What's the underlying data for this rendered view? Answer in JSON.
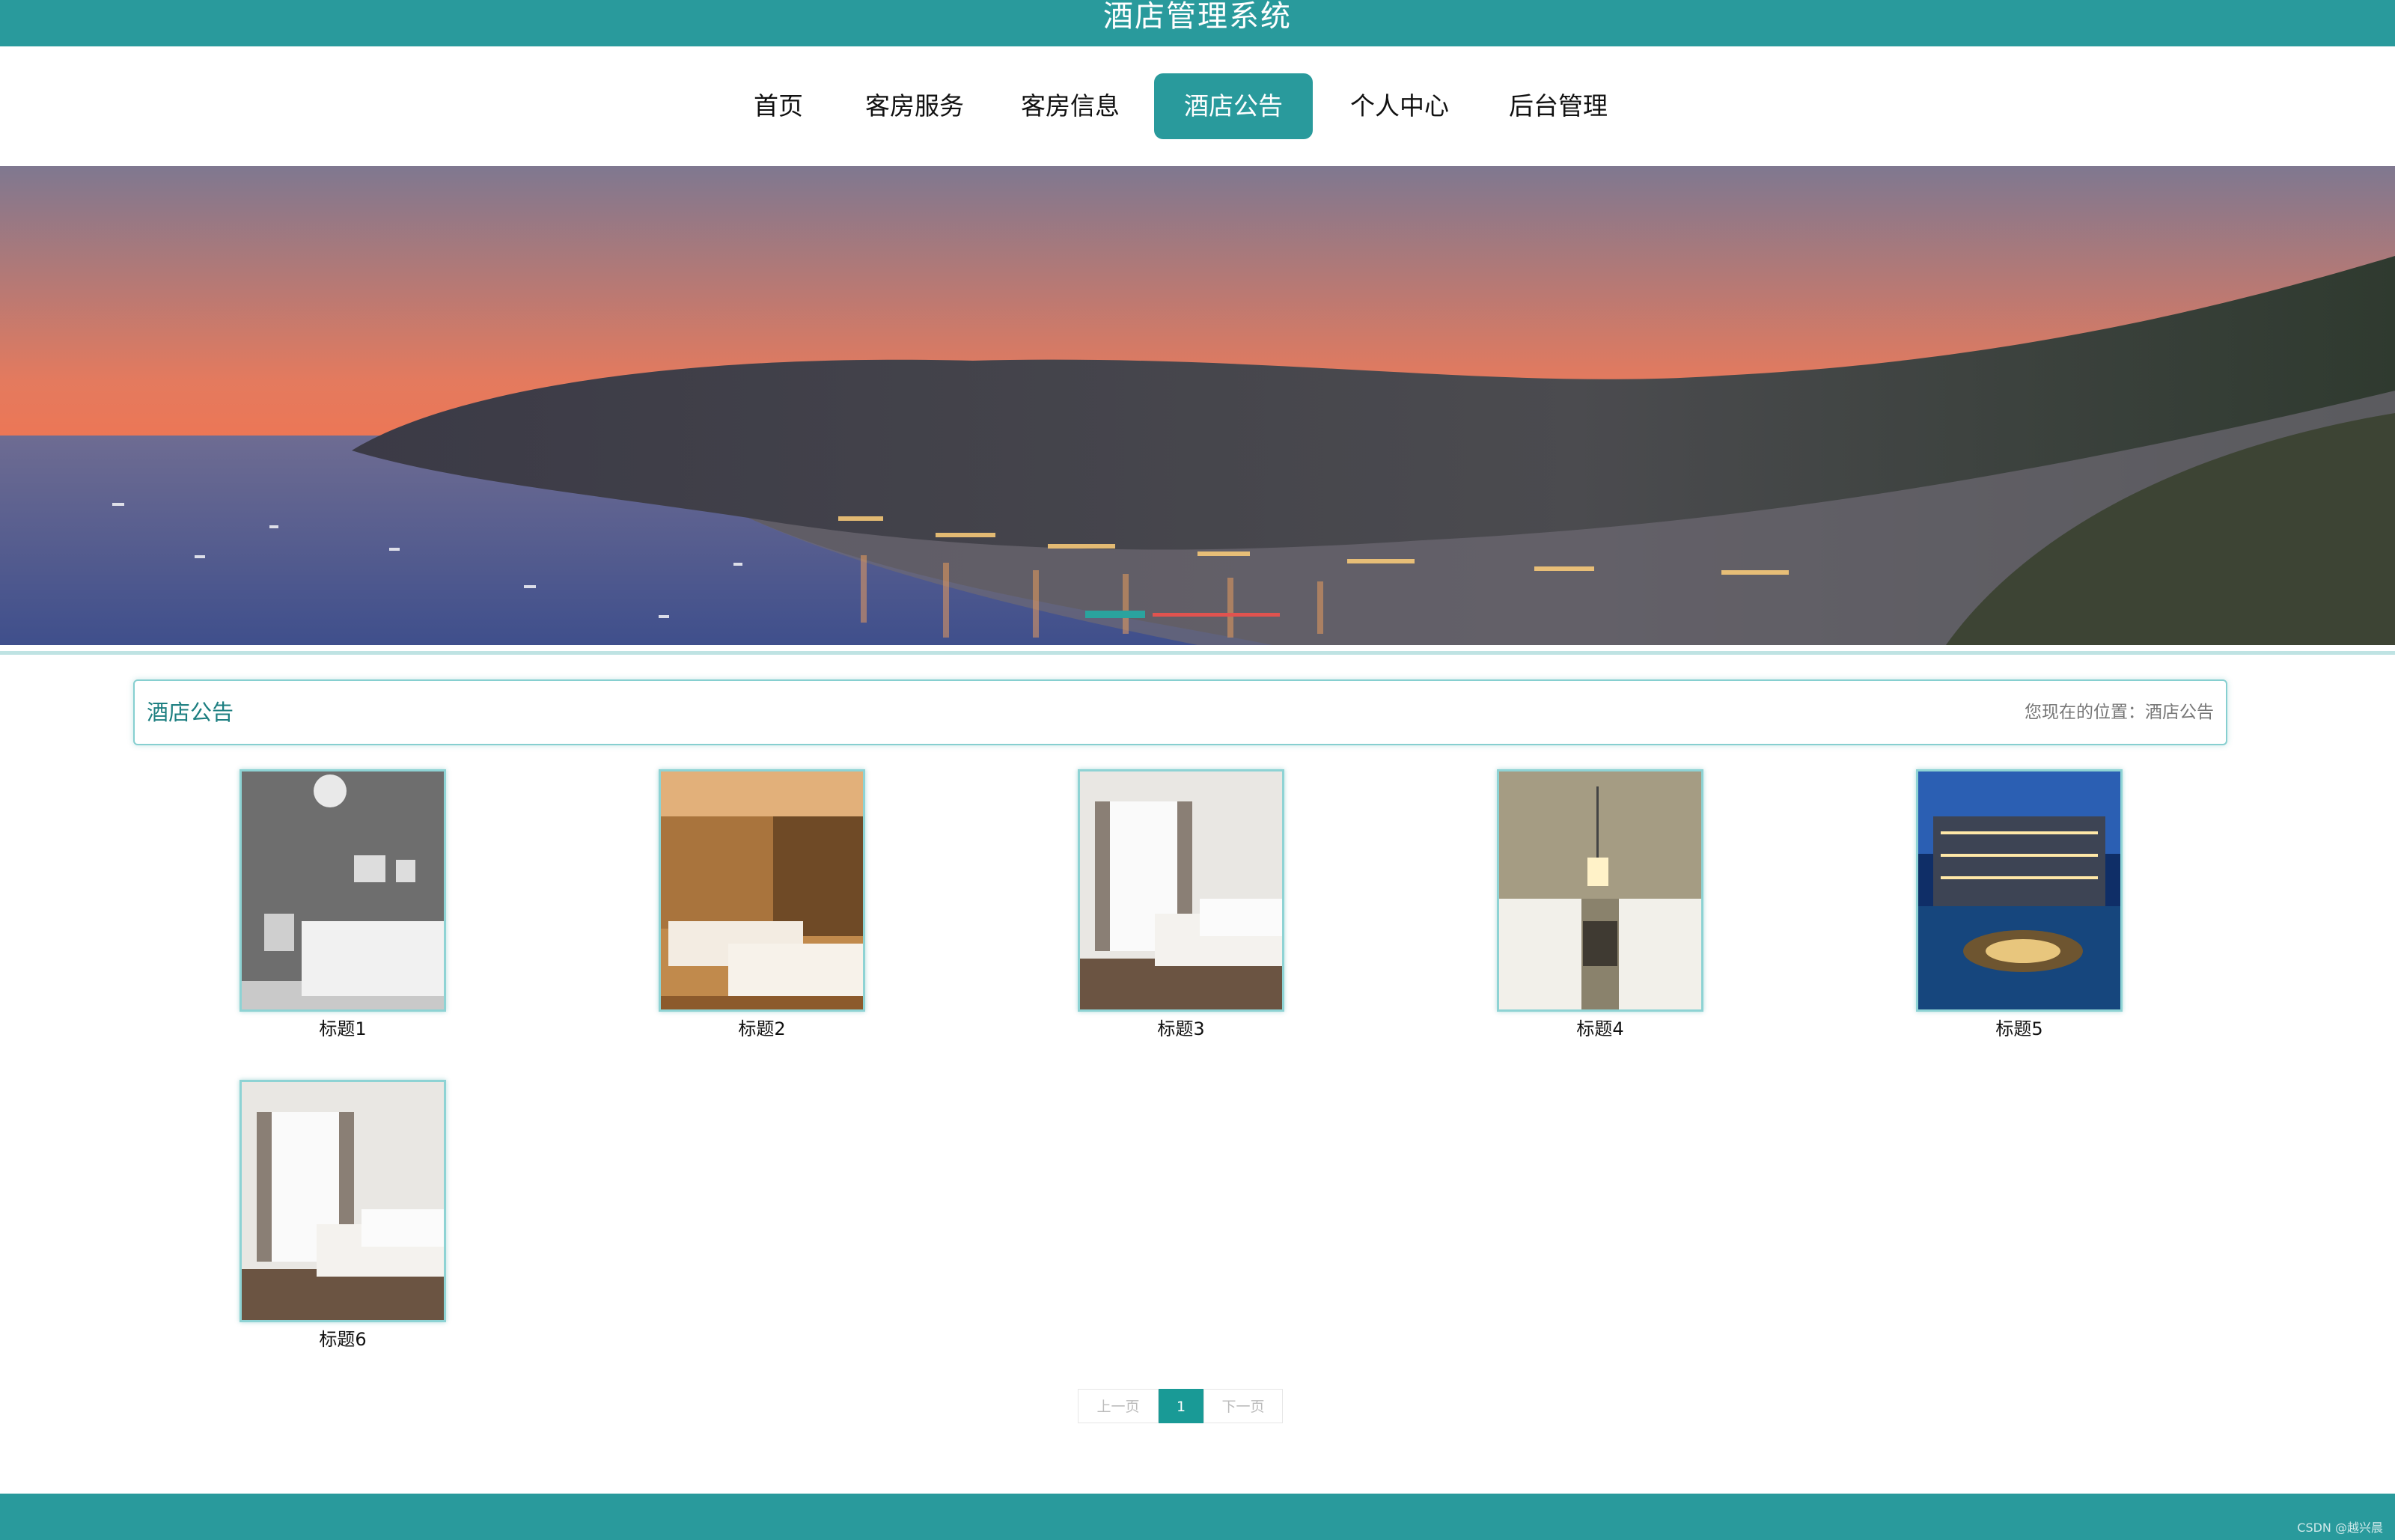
{
  "header": {
    "title": "酒店管理系统",
    "bar_color": "#299a9c"
  },
  "nav": {
    "items": [
      {
        "label": "首页"
      },
      {
        "label": "客房服务"
      },
      {
        "label": "客房信息"
      },
      {
        "label": "酒店公告",
        "active": true
      },
      {
        "label": "个人中心"
      },
      {
        "label": "后台管理"
      }
    ]
  },
  "banner": {
    "image": "coastal-town-sunset-photo"
  },
  "section": {
    "title": "酒店公告",
    "location": "您现在的位置：酒店公告"
  },
  "notices": [
    {
      "title": "标题1",
      "image": "gray-bedroom-photo"
    },
    {
      "title": "标题2",
      "image": "warm-twin-room-photo"
    },
    {
      "title": "标题3",
      "image": "bright-hotel-room-photo"
    },
    {
      "title": "标题4",
      "image": "twin-beds-pendant-lamp-photo"
    },
    {
      "title": "标题5",
      "image": "hotel-pool-night-photo"
    },
    {
      "title": "标题6",
      "image": "bright-hotel-room-photo"
    }
  ],
  "pagination": {
    "prev_label": "上一页",
    "current_page": "1",
    "next_label": "下一页"
  },
  "footer": {
    "watermark": "CSDN @越兴晨"
  },
  "colors": {
    "accent": "#299a9c",
    "page_active": "#199a96"
  }
}
